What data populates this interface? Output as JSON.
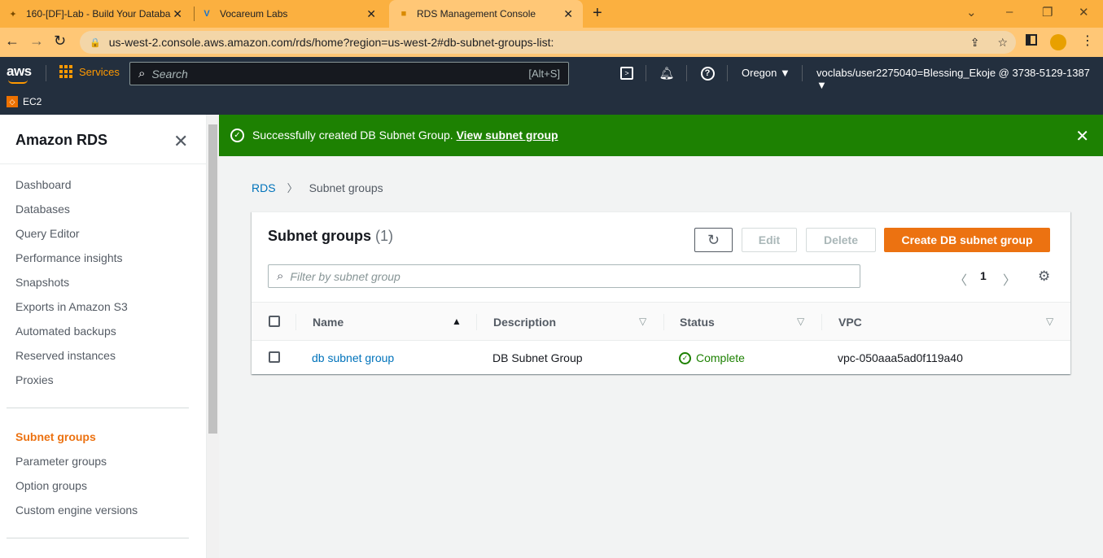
{
  "browser": {
    "tabs": [
      {
        "title": "160-[DF]-Lab - Build Your Databa",
        "icon": "lab-icon"
      },
      {
        "title": "Vocareum Labs",
        "icon": "vocareum-icon"
      },
      {
        "title": "RDS Management Console",
        "icon": "aws-box-icon"
      }
    ],
    "url": "us-west-2.console.aws.amazon.com/rds/home?region=us-west-2#db-subnet-groups-list:"
  },
  "aws_nav": {
    "logo": "aws",
    "services": "Services",
    "search_placeholder": "Search",
    "search_shortcut": "[Alt+S]",
    "region": "Oregon ▼",
    "account": "voclabs/user2275040=Blessing_Ekoje @ 3738-5129-1387 ▼",
    "favorite": "EC2"
  },
  "sidenav": {
    "header": "Amazon RDS",
    "items": [
      "Dashboard",
      "Databases",
      "Query Editor",
      "Performance insights",
      "Snapshots",
      "Exports in Amazon S3",
      "Automated backups",
      "Reserved instances",
      "Proxies"
    ],
    "items2": [
      "Subnet groups",
      "Parameter groups",
      "Option groups",
      "Custom engine versions"
    ]
  },
  "flash": {
    "message": "Successfully created DB Subnet Group.",
    "link": "View subnet group"
  },
  "breadcrumb": {
    "root": "RDS",
    "current": "Subnet groups"
  },
  "panel": {
    "title": "Subnet groups",
    "count": "(1)",
    "edit": "Edit",
    "delete": "Delete",
    "create": "Create DB subnet group",
    "filter_placeholder": "Filter by subnet group",
    "page": "1"
  },
  "table": {
    "columns": [
      "Name",
      "Description",
      "Status",
      "VPC"
    ],
    "rows": [
      {
        "name": "db subnet group",
        "description": "DB Subnet Group",
        "status": "Complete",
        "vpc": "vpc-050aaa5ad0f119a40"
      }
    ]
  },
  "colors": {
    "accent": "#ec7211",
    "success": "#1d8102",
    "link": "#0073bb",
    "nav_bg": "#232f3e"
  }
}
